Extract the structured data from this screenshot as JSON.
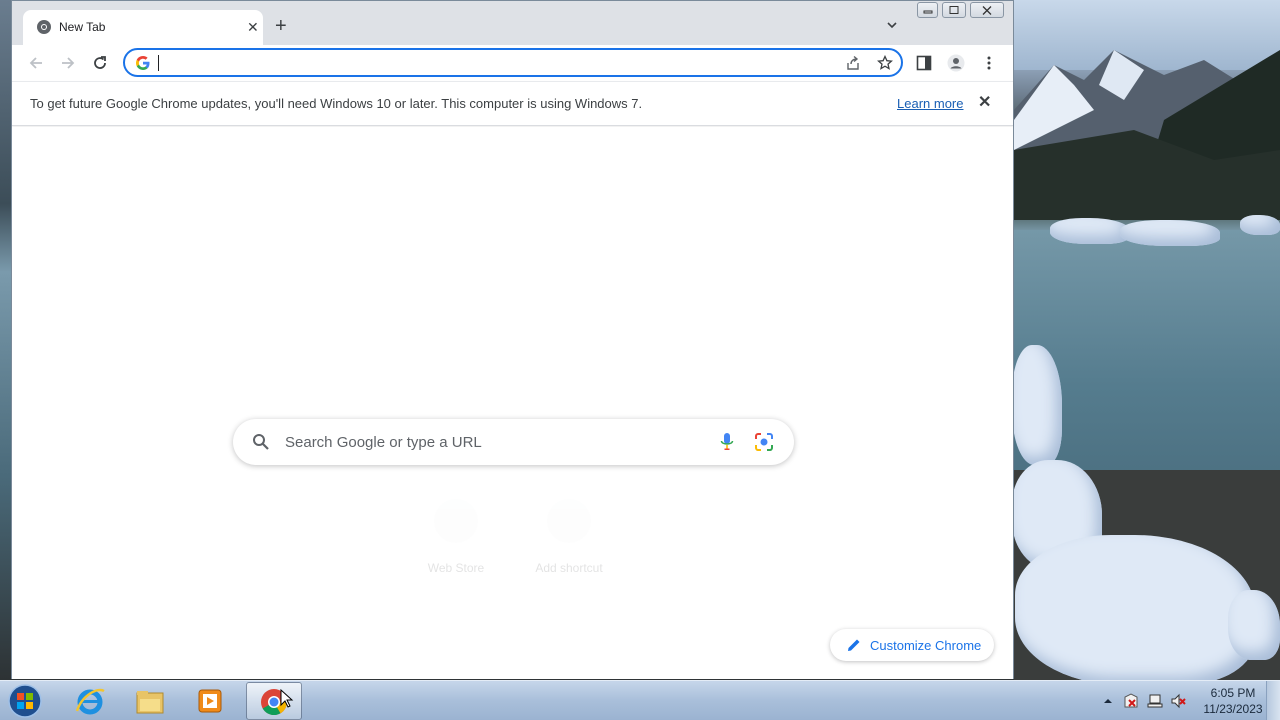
{
  "browser": {
    "tab": {
      "title": "New Tab",
      "favicon": "chrome-icon",
      "close_icon": "close-icon"
    },
    "new_tab_icon": "plus-icon",
    "tab_search_icon": "chevron-down-icon",
    "window_controls": [
      "minimize-icon",
      "maximize-icon",
      "close-icon"
    ],
    "toolbar": {
      "back_icon": "back-arrow-icon",
      "forward_icon": "forward-arrow-icon",
      "reload_icon": "reload-icon",
      "omnibox": {
        "value": "",
        "search_engine_icon": "google-g-icon",
        "share_icon": "share-icon",
        "bookmark_icon": "star-icon"
      },
      "side_panel_icon": "side-panel-icon",
      "profile_icon": "profile-icon",
      "menu_icon": "kebab-menu-icon"
    },
    "infobar": {
      "message": "To get future Google Chrome updates, you'll need Windows 10 or later. This computer is using Windows 7.",
      "link": "Learn more",
      "close_icon": "close-icon"
    },
    "new_tab_page": {
      "search_placeholder": "Search Google or type a URL",
      "voice_icon": "microphone-icon",
      "lens_icon": "camera-icon",
      "shortcuts": [
        {
          "label": "Web Store",
          "icon": "web-store-icon"
        },
        {
          "label": "Add shortcut",
          "icon": "plus-icon"
        }
      ],
      "customize_label": "Customize Chrome",
      "customize_icon": "pencil-icon"
    }
  },
  "taskbar": {
    "apps": [
      {
        "name": "internet-explorer",
        "icon": "ie-icon"
      },
      {
        "name": "file-explorer",
        "icon": "folder-icon"
      },
      {
        "name": "media-player",
        "icon": "media-player-icon"
      },
      {
        "name": "chrome",
        "icon": "chrome-icon",
        "active": true
      }
    ],
    "tray_icons": [
      "show-hidden-icon",
      "action-center-icon",
      "network-icon",
      "volume-muted-icon"
    ],
    "clock": {
      "time": "6:05 PM",
      "date": "11/23/2023"
    }
  }
}
